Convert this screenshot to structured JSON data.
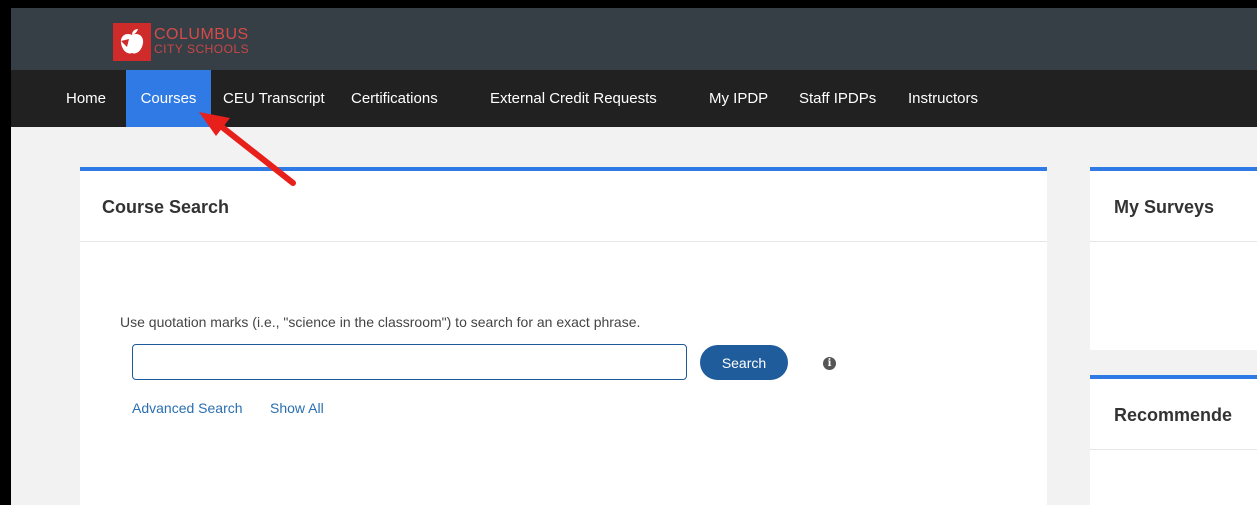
{
  "brand": {
    "line1": "COLUMBUS",
    "line2": "CITY SCHOOLS",
    "color": "#d02b2b"
  },
  "nav": {
    "home": "Home",
    "courses": "Courses",
    "ceu": "CEU Transcript",
    "certifications": "Certifications",
    "external": "External Credit Requests",
    "myipdp": "My IPDP",
    "staffipdps": "Staff IPDPs",
    "instructors": "Instructors"
  },
  "course_search": {
    "title": "Course Search",
    "hint": "Use quotation marks (i.e., \"science in the classroom\") to search for an exact phrase.",
    "input_value": "",
    "search_label": "Search",
    "info_glyph": "i",
    "advanced_label": "Advanced Search",
    "show_all_label": "Show All"
  },
  "surveys": {
    "title": "My Surveys"
  },
  "recommended": {
    "title": "Recommende"
  },
  "colors": {
    "accent": "#2f7ae5",
    "button": "#1f5c9c",
    "annotation_arrow": "#e8201c"
  }
}
